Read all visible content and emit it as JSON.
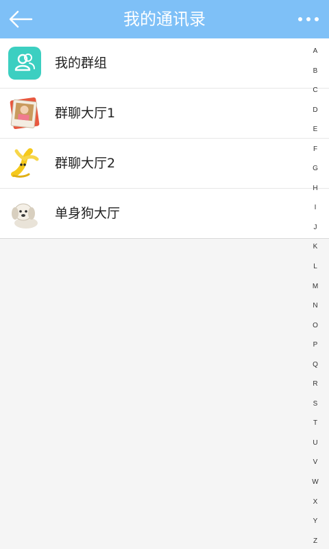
{
  "header": {
    "title": "我的通讯录",
    "back_icon": "arrow-left-icon",
    "more_icon": "more-dots-icon",
    "color": "#7ec0f7"
  },
  "contacts": [
    {
      "label": "我的群组",
      "icon": "group-icon"
    },
    {
      "label": "群聊大厅1",
      "icon": "photo-avatar"
    },
    {
      "label": "群聊大厅2",
      "icon": "banana-avatar"
    },
    {
      "label": "单身狗大厅",
      "icon": "dog-avatar"
    }
  ],
  "index": [
    "A",
    "B",
    "C",
    "D",
    "E",
    "F",
    "G",
    "H",
    "I",
    "J",
    "K",
    "L",
    "M",
    "N",
    "O",
    "P",
    "Q",
    "R",
    "S",
    "T",
    "U",
    "V",
    "W",
    "X",
    "Y",
    "Z"
  ]
}
